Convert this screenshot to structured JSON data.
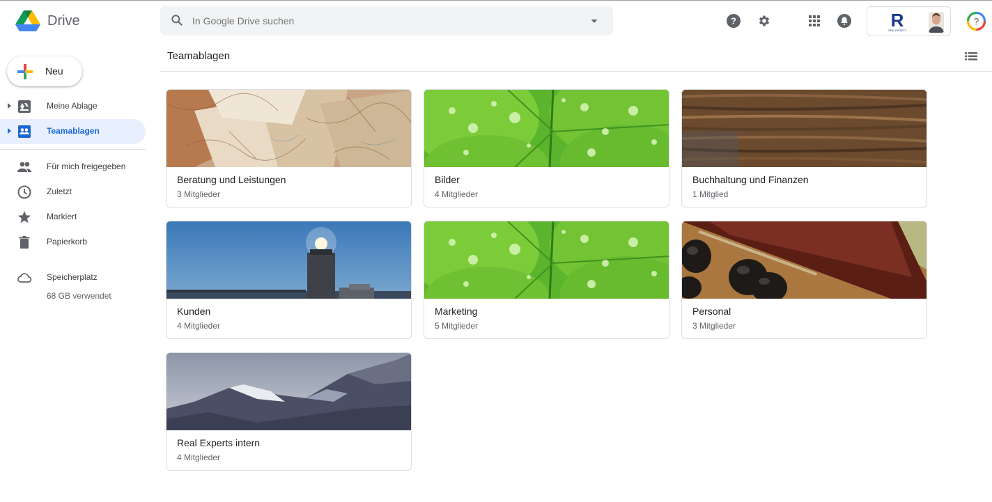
{
  "app": {
    "name": "Drive"
  },
  "search": {
    "placeholder": "In Google Drive suchen"
  },
  "header_icons": [
    "help-icon",
    "settings-icon",
    "apps-grid-icon",
    "notifications-icon",
    "help-ring-icon"
  ],
  "org_logo_text": "REAL EXPERTS",
  "sidebar": {
    "new_label": "Neu",
    "items": [
      {
        "label": "Meine Ablage",
        "icon": "drive-icon"
      },
      {
        "label": "Teamablagen",
        "icon": "shared-drives-icon",
        "active": true
      },
      {
        "label": "Für mich freigegeben",
        "icon": "people-icon"
      },
      {
        "label": "Zuletzt",
        "icon": "clock-icon"
      },
      {
        "label": "Markiert",
        "icon": "star-icon"
      },
      {
        "label": "Papierkorb",
        "icon": "trash-icon"
      },
      {
        "label": "Speicherplatz",
        "icon": "cloud-icon"
      }
    ],
    "storage_used": "68 GB verwendet"
  },
  "main": {
    "title": "Teamablagen",
    "cards": [
      {
        "name": "Beratung und Leistungen",
        "members": "3 Mitglieder",
        "theme": "maps"
      },
      {
        "name": "Bilder",
        "members": "4 Mitglieder",
        "theme": "clover"
      },
      {
        "name": "Buchhaltung und Finanzen",
        "members": "1 Mitglied",
        "theme": "wood"
      },
      {
        "name": "Kunden",
        "members": "4 Mitglieder",
        "theme": "lighthouse"
      },
      {
        "name": "Marketing",
        "members": "5 Mitglieder",
        "theme": "clover"
      },
      {
        "name": "Personal",
        "members": "3 Mitglieder",
        "theme": "abacus"
      },
      {
        "name": "Real Experts intern",
        "members": "4 Mitglieder",
        "theme": "mountains"
      }
    ]
  },
  "colors": {
    "accent": "#1967d2",
    "active_bg": "#e8f0fe",
    "search_bg": "#f1f3f4"
  }
}
